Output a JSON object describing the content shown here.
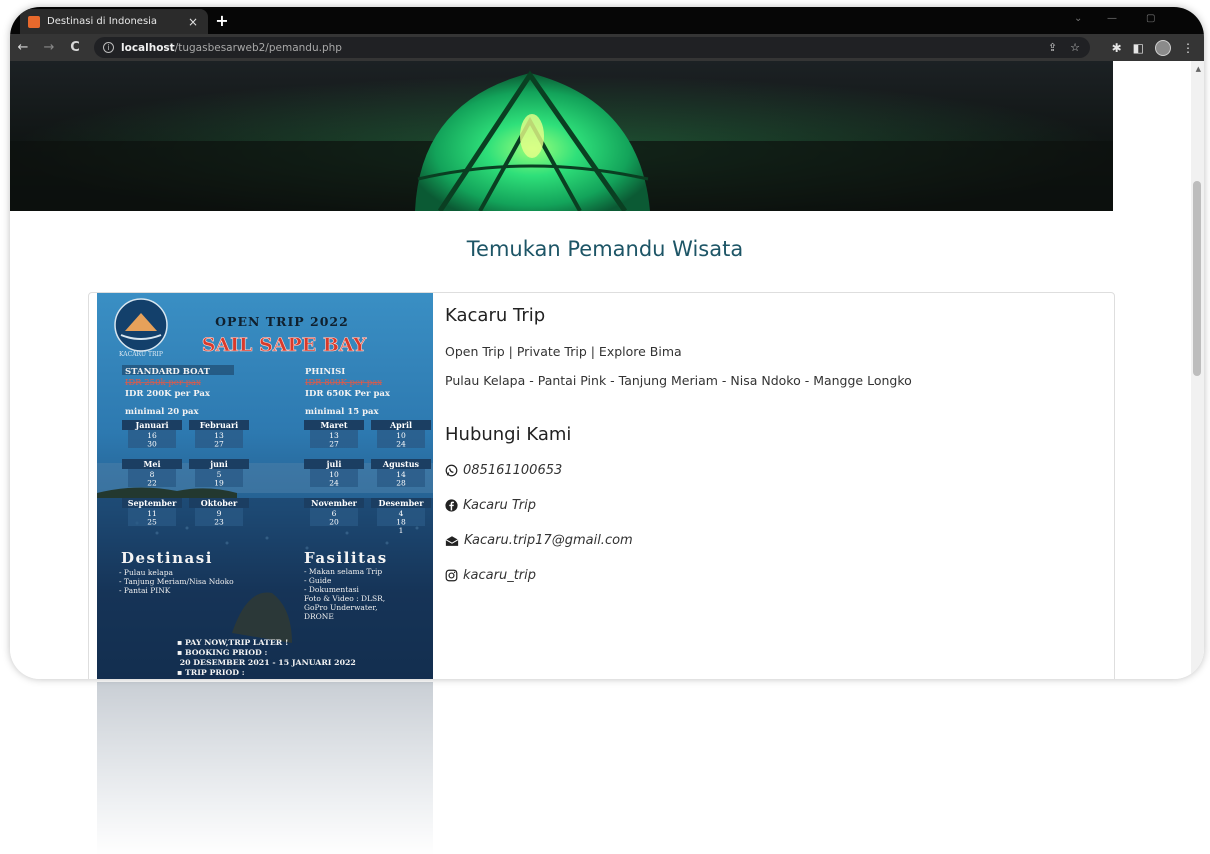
{
  "browser": {
    "tab_title": "Destinasi di Indonesia",
    "tab_close": "×",
    "new_tab": "+",
    "url_host": "localhost",
    "url_path": "/tugasbesarweb2/pemandu.php",
    "back": "←",
    "forward": "→",
    "reload": "C"
  },
  "page": {
    "title": "Temukan Pemandu Wisata"
  },
  "poster": {
    "heading": "OPEN TRIP 2022",
    "subheading": "SAIL SAPE BAY",
    "brand": "KACARU TRIP",
    "standard_boat": {
      "label": "STANDARD BOAT",
      "old_price": "IDR 250k per pax",
      "price": "IDR 200K per Pax",
      "minimum": "minimal 20 pax"
    },
    "phinisi": {
      "label": "PHINISI",
      "old_price": "IDR 800K per pax",
      "price": "IDR 650K Per pax",
      "minimum": "minimal 15 pax"
    },
    "months_left": [
      {
        "name": "Januari",
        "dates": "16\n30"
      },
      {
        "name": "Februari",
        "dates": "13\n27"
      },
      {
        "name": "Mei",
        "dates": "8\n22"
      },
      {
        "name": "juni",
        "dates": "5\n19"
      },
      {
        "name": "September",
        "dates": "11\n25"
      },
      {
        "name": "Oktober",
        "dates": "9\n23"
      }
    ],
    "months_right": [
      {
        "name": "Maret",
        "dates": "13\n27"
      },
      {
        "name": "April",
        "dates": "10\n24"
      },
      {
        "name": "juli",
        "dates": "10\n24"
      },
      {
        "name": "Agustus",
        "dates": "14\n28"
      },
      {
        "name": "November",
        "dates": "6\n20"
      },
      {
        "name": "Desember",
        "dates": "4\n18\n1"
      }
    ],
    "destinasi_title": "Destinasi",
    "destinasi_items": "- Pulau kelapa\n- Tanjung Meriam/Nisa Ndoko\n- Pantai PINK",
    "fasilitas_title": "Fasilitas",
    "fasilitas_items": "- Makan selama Trip\n- Guide\n- Dokumentasi\nFoto & Video : DLSR,\nGoPro Underwater,\nDRONE",
    "notes": "▪ PAY NOW,TRIP LATER !\n▪ BOOKING PRIOD :\n  20 DESEMBER 2021 - 15 JANUARI 2022\n▪ TRIP PRIOD :"
  },
  "card": {
    "title": "Kacaru Trip",
    "types": "Open Trip | Private Trip | Explore Bima",
    "route": "Pulau Kelapa - Pantai Pink - Tanjung Meriam - Nisa Ndoko - Mangge Longko",
    "contact_heading": "Hubungi Kami",
    "whatsapp": "085161100653",
    "facebook": "Kacaru Trip",
    "email": "Kacaru.trip17@gmail.com",
    "instagram": "kacaru_trip"
  },
  "colors": {
    "title_color": "#1d5566",
    "tent_glow": "#2fe07a",
    "poster_title_red": "#d93a2b"
  }
}
